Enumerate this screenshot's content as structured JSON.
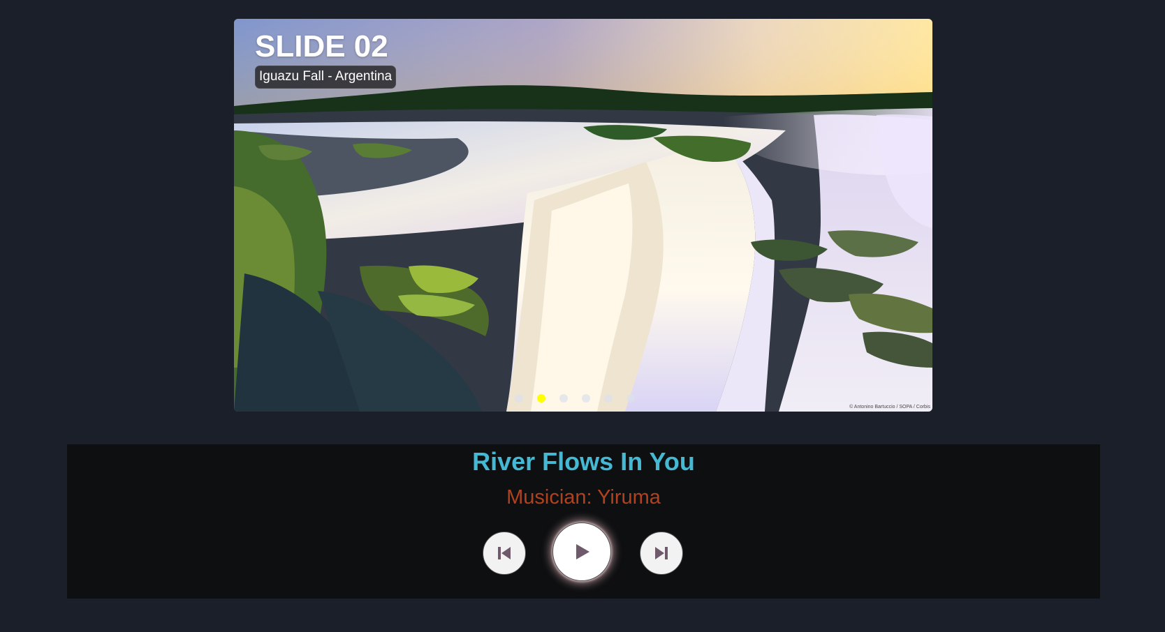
{
  "slider": {
    "slide_label": "SLIDE 02",
    "caption": "Iguazu Fall - Argentina",
    "credit": "© Antonino Bartuccio / SOPA / Corbis",
    "dots": [
      {
        "active": false
      },
      {
        "active": true
      },
      {
        "active": false
      },
      {
        "active": false
      },
      {
        "active": false
      },
      {
        "active": false
      }
    ],
    "active_dot_color": "#ffff00"
  },
  "player": {
    "song_title": "River Flows In You",
    "musician": "Musician: Yiruma",
    "controls": {
      "previous_icon": "skip-previous-icon",
      "play_icon": "play-icon",
      "next_icon": "skip-next-icon"
    }
  },
  "colors": {
    "page_bg": "#1b1f2a",
    "player_bg": "#0e0f11",
    "song_title": "#45b8d3",
    "musician": "#b1421f"
  }
}
